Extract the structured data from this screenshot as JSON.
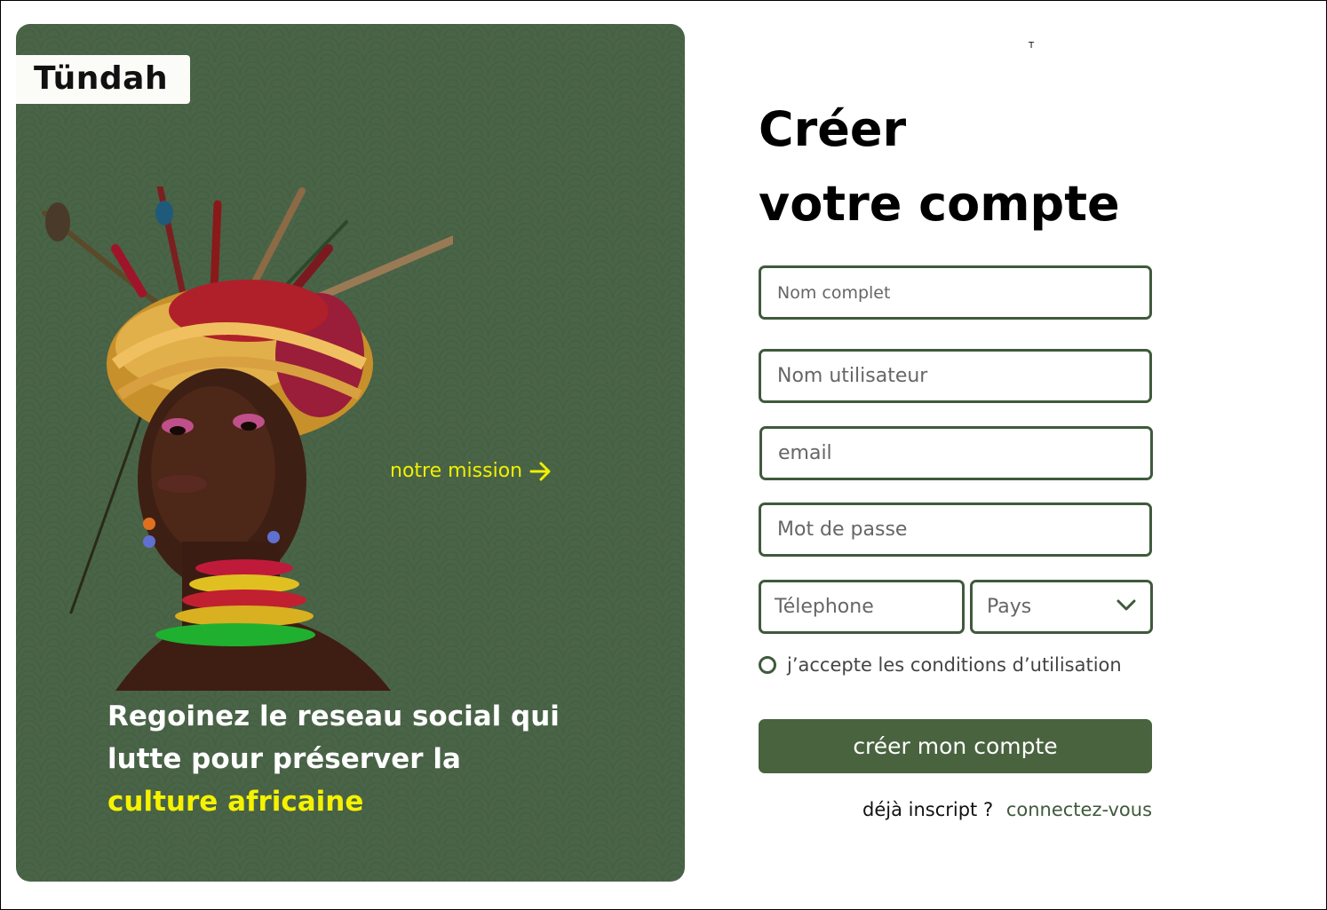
{
  "brand": {
    "logo_text": "Tündah"
  },
  "hero": {
    "mission_link": "notre mission",
    "tagline_plain": "Regoinez le reseau social qui lutte pour préserver la ",
    "tagline_highlight": "culture africaine",
    "portrait_alt": "portrait-photo"
  },
  "colors": {
    "brand_green": "#49633f",
    "highlight_yellow": "#f6f200",
    "field_border": "#3f5a3c"
  },
  "form": {
    "corner_mark": "T",
    "title_line1": "Créer",
    "title_line2": "votre compte",
    "fields": {
      "full_name": {
        "placeholder": "Nom complet",
        "value": ""
      },
      "username": {
        "placeholder": "Nom utilisateur",
        "value": ""
      },
      "email": {
        "placeholder": "email",
        "value": ""
      },
      "password": {
        "placeholder": "Mot de passe",
        "value": ""
      },
      "phone": {
        "placeholder": "Télephone",
        "value": ""
      },
      "country": {
        "selected": "Pays",
        "icon": "chevron-down-icon"
      }
    },
    "terms_label": "j’accepte les conditions d’utilisation",
    "submit_label": "créer mon compte",
    "already_registered": "déjà inscript ?",
    "login_link": "connectez-vous"
  }
}
